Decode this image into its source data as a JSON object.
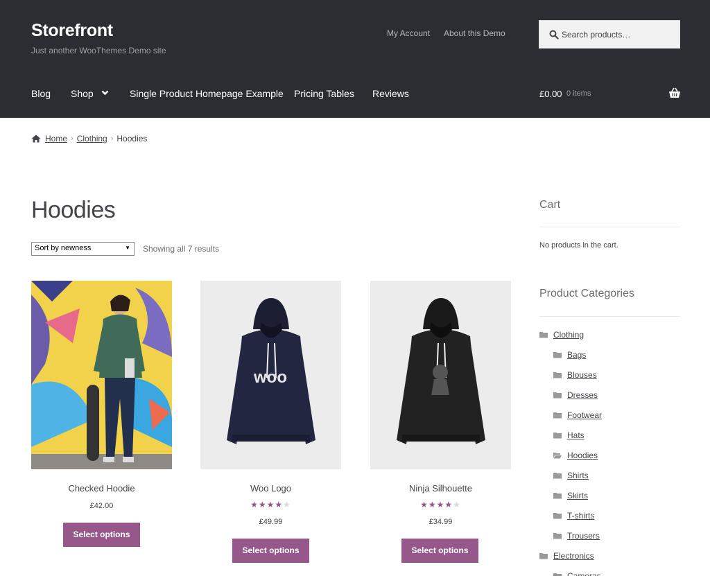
{
  "header": {
    "site_title": "Storefront",
    "tagline": "Just another WooThemes Demo site",
    "secondary_nav": [
      "My Account",
      "About this Demo"
    ],
    "search_placeholder": "Search products…",
    "main_nav": [
      "Blog",
      "Shop",
      "Single Product Homepage Example",
      "Pricing Tables",
      "Reviews"
    ],
    "cart_total": "£0.00",
    "cart_count": "0 items"
  },
  "breadcrumb": {
    "items": [
      "Home",
      "Clothing",
      "Hoodies"
    ]
  },
  "page": {
    "title": "Hoodies",
    "sort_selected": "Sort by newness",
    "result_count": "Showing all 7 results"
  },
  "products": [
    {
      "name": "Checked Hoodie",
      "price": "£42.00",
      "rating": null,
      "button": "Select options"
    },
    {
      "name": "Woo Logo",
      "price": "£49.99",
      "rating": 4,
      "button": "Select options"
    },
    {
      "name": "Ninja Silhouette",
      "price": "£34.99",
      "rating": 4,
      "button": "Select options"
    }
  ],
  "sidebar": {
    "cart_title": "Cart",
    "cart_empty": "No products in the cart.",
    "categories_title": "Product Categories",
    "categories": [
      {
        "label": "Clothing",
        "level": 0
      },
      {
        "label": "Bags",
        "level": 1
      },
      {
        "label": "Blouses",
        "level": 1
      },
      {
        "label": "Dresses",
        "level": 1
      },
      {
        "label": "Footwear",
        "level": 1
      },
      {
        "label": "Hats",
        "level": 1
      },
      {
        "label": "Hoodies",
        "level": 1,
        "current": true
      },
      {
        "label": "Shirts",
        "level": 1
      },
      {
        "label": "Skirts",
        "level": 1
      },
      {
        "label": "T-shirts",
        "level": 1
      },
      {
        "label": "Trousers",
        "level": 1
      },
      {
        "label": "Electronics",
        "level": 0
      },
      {
        "label": "Cameras",
        "level": 1
      }
    ]
  },
  "colors": {
    "header_bg": "#2c2d33",
    "accent": "#96588a",
    "text": "#43454b"
  }
}
